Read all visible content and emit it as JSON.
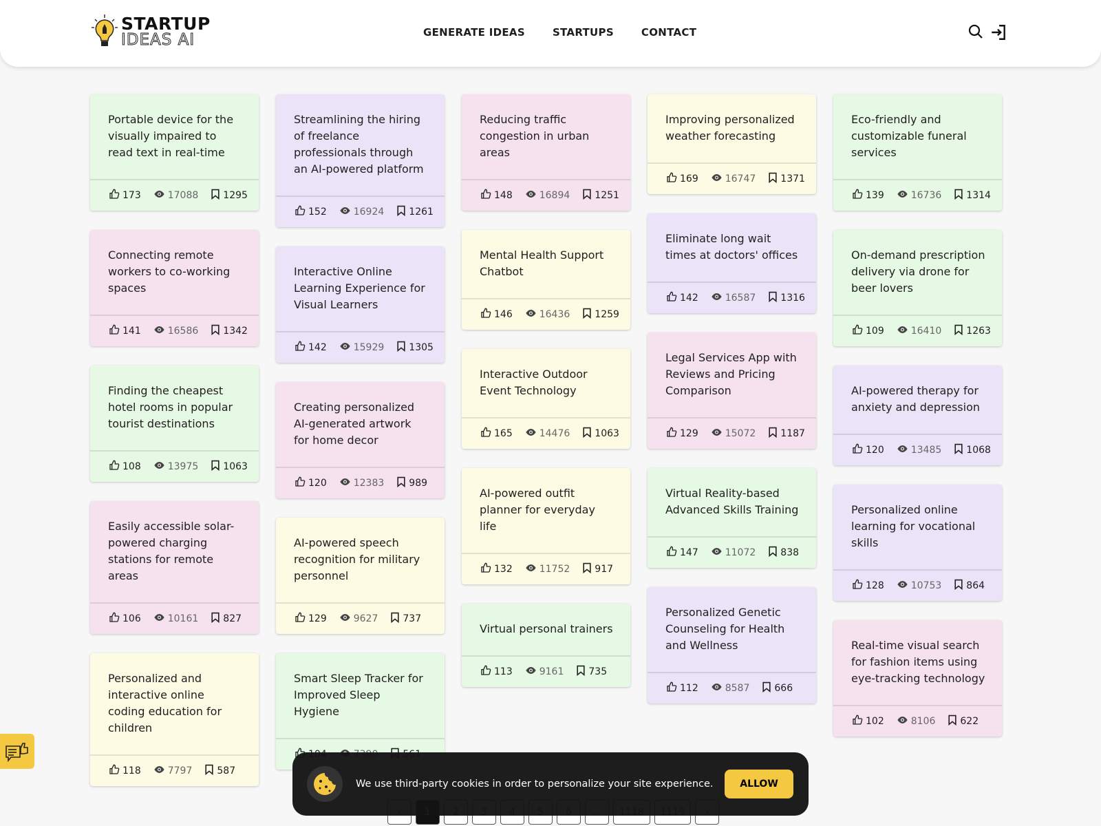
{
  "header": {
    "logo_top": "STARTUP",
    "logo_bottom": "IDEAS AI",
    "nav": [
      "GENERATE IDEAS",
      "STARTUPS",
      "CONTACT"
    ]
  },
  "colors": {
    "green": "#e6f9e5",
    "purple": "#ebe4f8",
    "pink": "#f6e2ee",
    "yellow": "#fdfbe3",
    "accent": "#f5c842"
  },
  "columns": [
    [
      {
        "c": "green",
        "t": "Portable device for the visually impaired to read text in real-time",
        "l": "173",
        "v": "17088",
        "s": "1295"
      },
      {
        "c": "pink",
        "t": "Connecting remote workers to co-working spaces",
        "l": "141",
        "v": "16586",
        "s": "1342"
      },
      {
        "c": "green",
        "t": "Finding the cheapest hotel rooms in popular tourist destinations",
        "l": "108",
        "v": "13975",
        "s": "1063"
      },
      {
        "c": "pink",
        "t": "Easily accessible solar-powered charging stations for remote areas",
        "l": "106",
        "v": "10161",
        "s": "827"
      },
      {
        "c": "yellow",
        "t": "Personalized and interactive online coding education for children",
        "l": "118",
        "v": "7797",
        "s": "587"
      }
    ],
    [
      {
        "c": "purple",
        "t": "Streamlining the hiring of freelance professionals through an AI-powered platform",
        "l": "152",
        "v": "16924",
        "s": "1261"
      },
      {
        "c": "purple",
        "t": "Interactive Online Learning Experience for Visual Learners",
        "l": "142",
        "v": "15929",
        "s": "1305"
      },
      {
        "c": "pink",
        "t": "Creating personalized AI-generated artwork for home decor",
        "l": "120",
        "v": "12383",
        "s": "989"
      },
      {
        "c": "yellow",
        "t": "AI-powered speech recognition for military personnel",
        "l": "129",
        "v": "9627",
        "s": "737"
      },
      {
        "c": "green",
        "t": "Smart Sleep Tracker for Improved Sleep Hygiene",
        "l": "104",
        "v": "7390",
        "s": "561"
      }
    ],
    [
      {
        "c": "pink",
        "t": "Reducing traffic congestion in urban areas",
        "l": "148",
        "v": "16894",
        "s": "1251"
      },
      {
        "c": "yellow",
        "t": "Mental Health Support Chatbot",
        "l": "146",
        "v": "16436",
        "s": "1259"
      },
      {
        "c": "yellow",
        "t": "Interactive Outdoor Event Technology",
        "l": "165",
        "v": "14476",
        "s": "1063"
      },
      {
        "c": "yellow",
        "t": "AI-powered outfit planner for everyday life",
        "l": "132",
        "v": "11752",
        "s": "917"
      },
      {
        "c": "green",
        "t": "Virtual personal trainers",
        "l": "113",
        "v": "9161",
        "s": "735"
      }
    ],
    [
      {
        "c": "yellow",
        "t": "Improving personalized weather forecasting",
        "l": "169",
        "v": "16747",
        "s": "1371"
      },
      {
        "c": "purple",
        "t": "Eliminate long wait times at doctors' offices",
        "l": "142",
        "v": "16587",
        "s": "1316"
      },
      {
        "c": "pink",
        "t": "Legal Services App with Reviews and Pricing Comparison",
        "l": "129",
        "v": "15072",
        "s": "1187"
      },
      {
        "c": "green",
        "t": "Virtual Reality-based Advanced Skills Training",
        "l": "147",
        "v": "11072",
        "s": "838"
      },
      {
        "c": "purple",
        "t": "Personalized Genetic Counseling for Health and Wellness",
        "l": "112",
        "v": "8587",
        "s": "666"
      }
    ],
    [
      {
        "c": "green",
        "t": "Eco-friendly and customizable funeral services",
        "l": "139",
        "v": "16736",
        "s": "1314"
      },
      {
        "c": "green",
        "t": "On-demand prescription delivery via drone for beer lovers",
        "l": "109",
        "v": "16410",
        "s": "1263"
      },
      {
        "c": "purple",
        "t": "AI-powered therapy for anxiety and depression",
        "l": "120",
        "v": "13485",
        "s": "1068"
      },
      {
        "c": "purple",
        "t": "Personalized online learning for vocational skills",
        "l": "128",
        "v": "10753",
        "s": "864"
      },
      {
        "c": "pink",
        "t": "Real-time visual search for fashion items using eye-tracking technology",
        "l": "102",
        "v": "8106",
        "s": "622"
      }
    ]
  ],
  "pagination": {
    "prev": "‹",
    "pages": [
      "1",
      "2",
      "3",
      "4",
      "5",
      "6",
      "...",
      "1118",
      "1119"
    ],
    "next": "›",
    "current": "1"
  },
  "cookie": {
    "text": "We use third-party cookies in order to personalize your site experience.",
    "allow": "ALLOW"
  }
}
